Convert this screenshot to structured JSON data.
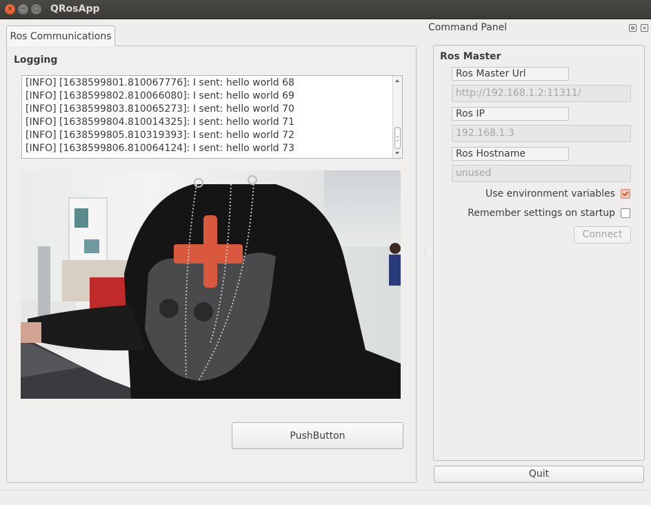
{
  "window": {
    "title": "QRosApp",
    "close_glyph": "×",
    "minimize_glyph": "−",
    "maximize_glyph": "□"
  },
  "tabs": [
    {
      "label": "Ros Communications",
      "selected": true
    }
  ],
  "logging": {
    "title": "Logging",
    "lines": [
      "[INFO] [1638599801.810067776]: I sent: hello world 68",
      "[INFO] [1638599802.810066080]: I sent: hello world 69",
      "[INFO] [1638599803.810065273]: I sent: hello world 70",
      "[INFO] [1638599804.810014325]: I sent: hello world 71",
      "[INFO] [1638599805.810319393]: I sent: hello world 72",
      "[INFO] [1638599806.810064124]: I sent: hello world 73"
    ]
  },
  "main": {
    "push_button_label": "PushButton"
  },
  "command_panel": {
    "title": "Command Panel",
    "float_glyph": "⧉",
    "close_glyph": "×",
    "group_title": "Ros Master",
    "master_url": {
      "label": "Ros Master Url",
      "value": "http://192.168.1.2:11311/"
    },
    "ros_ip": {
      "label": "Ros IP",
      "value": "192.168.1.3"
    },
    "ros_hostname": {
      "label": "Ros Hostname",
      "value": "unused"
    },
    "use_env": {
      "label": "Use environment variables",
      "checked": true
    },
    "remember": {
      "label": "Remember settings on startup",
      "checked": false
    },
    "connect_label": "Connect",
    "quit_label": "Quit"
  },
  "colors": {
    "accent": "#d2532a",
    "titlebar": "#3e3d39",
    "background": "#efeeec"
  }
}
